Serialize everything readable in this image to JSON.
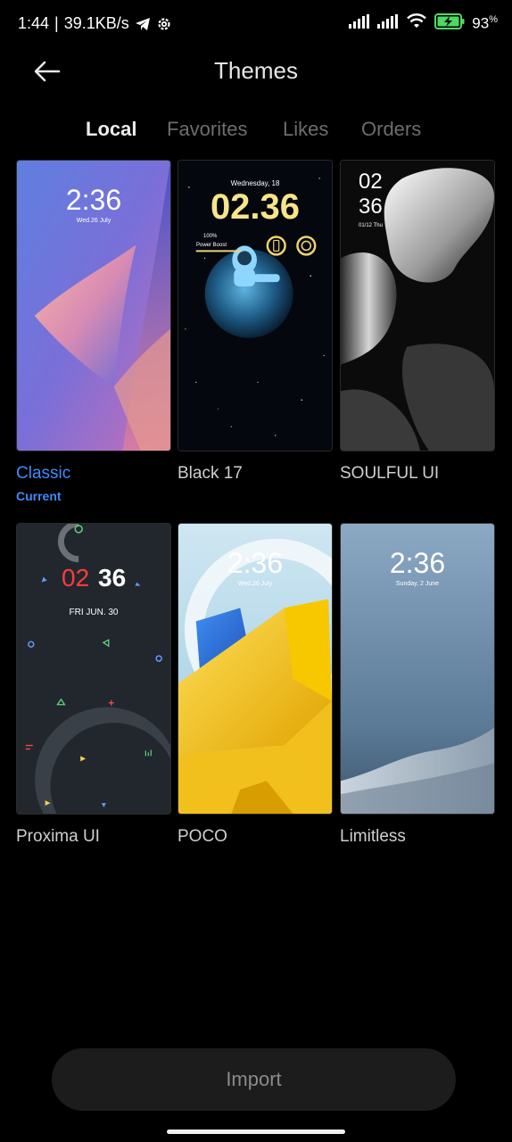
{
  "status_bar": {
    "time": "1:44",
    "separator": "|",
    "network_speed": "39.1KB/s",
    "battery_percent": "93",
    "battery_unit": "%",
    "icons": [
      "telegram-icon",
      "settings-gear-icon",
      "signal-icon",
      "signal-icon",
      "wifi-icon",
      "battery-charging-icon"
    ]
  },
  "header": {
    "title": "Themes",
    "back_icon": "arrow-left-icon"
  },
  "tabs": [
    {
      "label": "Local",
      "active": true
    },
    {
      "label": "Favorites",
      "active": false
    },
    {
      "label": "Likes",
      "active": false
    },
    {
      "label": "Orders",
      "active": false
    }
  ],
  "themes": [
    {
      "name": "Classic",
      "status": "Current",
      "preview": {
        "time": "2:36",
        "date": "Wed.26 July"
      }
    },
    {
      "name": "Black 17",
      "preview": {
        "date": "Wednesday, 18",
        "time": "02.36",
        "battery": "100%",
        "mode": "Power Boost"
      }
    },
    {
      "name": "SOULFUL UI",
      "preview": {
        "hour": "02",
        "minute": "36",
        "date": "01/12 Thu"
      }
    },
    {
      "name": "Proxima UI",
      "preview": {
        "hour": "02",
        "minute": "36",
        "date": "FRI JUN. 30"
      }
    },
    {
      "name": "POCO",
      "preview": {
        "time": "2:36",
        "date": "Wed.26 July"
      }
    },
    {
      "name": "Limitless",
      "preview": {
        "time": "2:36",
        "date": "Sunday, 2 June"
      }
    }
  ],
  "import_label": "Import",
  "colors": {
    "accent": "#3d8bff",
    "background": "#000000",
    "battery": "#4cd964"
  }
}
